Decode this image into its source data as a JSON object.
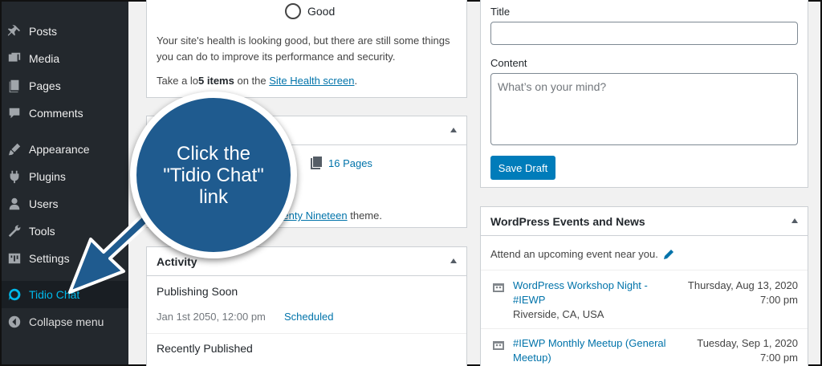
{
  "sidebar": {
    "items": [
      {
        "label": "Posts",
        "icon": "pushpin-icon"
      },
      {
        "label": "Media",
        "icon": "media-icon"
      },
      {
        "label": "Pages",
        "icon": "pages-icon"
      },
      {
        "label": "Comments",
        "icon": "comments-icon"
      },
      {
        "label": "Appearance",
        "icon": "appearance-icon"
      },
      {
        "label": "Plugins",
        "icon": "plugins-icon"
      },
      {
        "label": "Users",
        "icon": "users-icon"
      },
      {
        "label": "Tools",
        "icon": "tools-icon"
      },
      {
        "label": "Settings",
        "icon": "settings-icon"
      },
      {
        "label": "Tidio Chat",
        "icon": "tidio-icon"
      }
    ],
    "collapse_label": "Collapse menu"
  },
  "site_health": {
    "status": "Good",
    "message": "Your site's health is looking good, but there are still some things you can do to improve its performance and security.",
    "cta_prefix": "Take a lo",
    "cta_count": "5 items",
    "cta_middle": " on the ",
    "cta_link": "Site Health screen",
    "cta_suffix": "."
  },
  "at_a_glance": {
    "pages_link": "16 Pages",
    "theme_link": "wenty Nineteen",
    "theme_suffix": " theme."
  },
  "activity": {
    "title": "Activity",
    "publishing_soon": "Publishing Soon",
    "scheduled_date": "Jan 1st 2050, 12:00 pm",
    "scheduled_link": "Scheduled",
    "recently_published": "Recently Published"
  },
  "quick_draft": {
    "title_label": "Title",
    "title_value": "",
    "content_label": "Content",
    "content_placeholder": "What’s on your mind?",
    "save_label": "Save Draft"
  },
  "events": {
    "title": "WordPress Events and News",
    "intro": "Attend an upcoming event near you.",
    "items": [
      {
        "name_line1": "WordPress Workshop Night -",
        "name_line2": "#IEWP",
        "location": "Riverside, CA, USA",
        "date": "Thursday, Aug 13, 2020",
        "time": "7:00 pm"
      },
      {
        "name_line1": "#IEWP Monthly Meetup (General",
        "name_line2": "Meetup)",
        "location": "",
        "date": "Tuesday, Sep 1, 2020",
        "time": "7:00 pm"
      }
    ]
  },
  "callout": {
    "line1": "Click the",
    "line2": "\"Tidio Chat\"",
    "line3": "link"
  },
  "colors": {
    "sidebar_bg": "#23282d",
    "accent": "#0073aa",
    "callout": "#1f5b8f",
    "tidio": "#00b9eb"
  }
}
